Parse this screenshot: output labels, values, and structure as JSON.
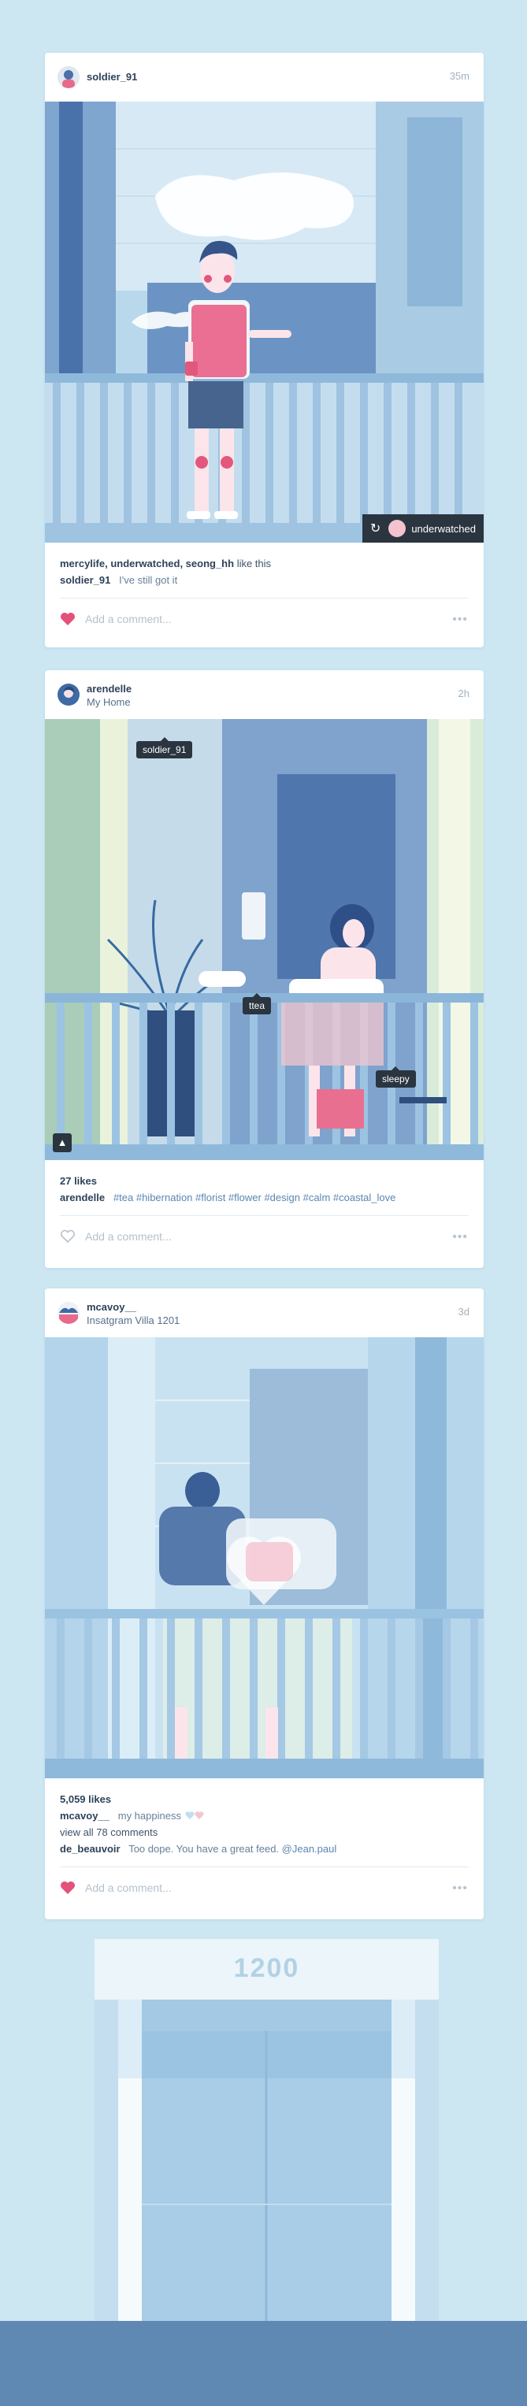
{
  "posts": [
    {
      "username": "soldier_91",
      "location": "",
      "time": "35m",
      "repost_user": "underwatched",
      "likes_line_users": "mercylife, underwatched, seong_hh",
      "likes_line_suffix": "like this",
      "caption_user": "soldier_91",
      "caption_text": "I've still got it",
      "comment_placeholder": "Add a comment...",
      "liked": true,
      "more": "•••"
    },
    {
      "username": "arendelle",
      "location": "My Home",
      "time": "2h",
      "tags_in_photo": [
        "soldier_91",
        "ttea",
        "sleepy"
      ],
      "likes": "27 likes",
      "caption_user": "arendelle",
      "caption_text": "#tea #hibernation #florist #flower #design #calm #coastal_love",
      "comment_placeholder": "Add a comment...",
      "liked": false,
      "more": "•••"
    },
    {
      "username": "mcavoy__",
      "location": "Insatgram Villa 1201",
      "time": "3d",
      "likes": "5,059 likes",
      "caption_user": "mcavoy__",
      "caption_text": "my happiness",
      "view_all": "view all 78 comments",
      "comment_user": "de_beauvoir",
      "comment_text": "Too dope. You have a great feed.",
      "comment_mention": "@Jean.paul",
      "comment_placeholder": "Add a comment...",
      "liked": true,
      "more": "•••"
    }
  ],
  "building_sign": "1200",
  "colors": {
    "background": "#cce6f2",
    "accent_heart": "#e4517a",
    "dark_pill": "#2a3540",
    "ground": "#5f88b3"
  }
}
